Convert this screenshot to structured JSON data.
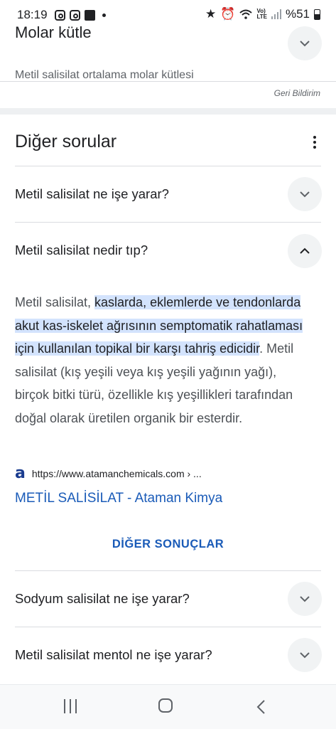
{
  "status_bar": {
    "time": "18:19",
    "left_icons": [
      "instagram-icon",
      "instagram-icon",
      "gallery-icon",
      "dot-icon"
    ],
    "right_icons": [
      "star-icon",
      "alarm-icon",
      "wifi-icon",
      "volte-icon",
      "signal-icon",
      "battery-icon"
    ],
    "volte_line1": "Vo)",
    "volte_line2": "LTE",
    "battery_percent": "%51"
  },
  "molar_card": {
    "title": "Molar kütle",
    "subtitle": "Metil salisilat ortalama molar kütlesi",
    "feedback": "Geri Bildirim"
  },
  "questions_card": {
    "title": "Diğer sorular",
    "q1": "Metil salisilat ne işe yarar?",
    "q2": "Metil salisilat nedir tıp?",
    "answer_pre": "Metil salisilat, ",
    "answer_highlight": "kaslarda, eklemlerde ve tendonlarda akut kas-iskelet ağrısının semptomatik rahatlaması için kullanılan topikal bir karşı tahriş edicidir",
    "answer_post": ". Metil salisilat (kış yeşili veya kış yeşili yağının yağı), birçok bitki türü, özellikle kış yeşillikleri tarafından doğal olarak üretilen organik bir esterdir.",
    "source_logo": "a",
    "source_url": "https://www.atamanchemicals.com › ...",
    "source_title": "METİL SALİSİLAT - Ataman Kimya",
    "more_results": "DİĞER SONUÇLAR",
    "q3": "Sodyum salisilat ne işe yarar?",
    "q4": "Metil salisilat mentol ne işe yarar?"
  },
  "colors": {
    "highlight": "#d3e3fd",
    "link": "#1a5bb8",
    "chevron_bg": "#f1f3f4"
  }
}
